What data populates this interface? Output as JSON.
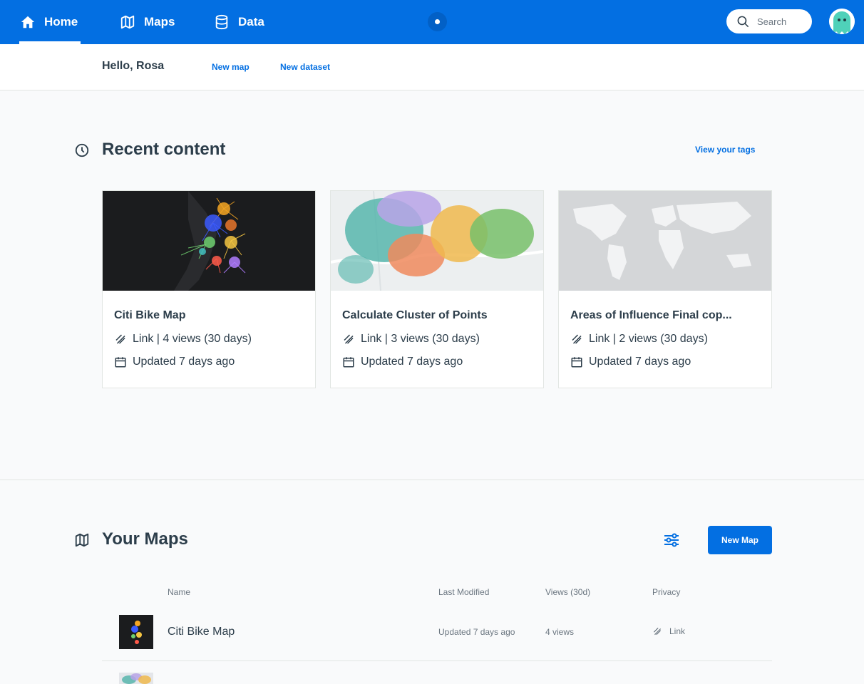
{
  "nav": {
    "items": [
      {
        "label": "Home",
        "icon": "home-icon",
        "active": true
      },
      {
        "label": "Maps",
        "icon": "map-icon",
        "active": false
      },
      {
        "label": "Data",
        "icon": "database-icon",
        "active": false
      }
    ],
    "search_placeholder": "Search"
  },
  "subheader": {
    "greeting": "Hello, Rosa",
    "new_map": "New map",
    "new_dataset": "New dataset"
  },
  "recent": {
    "title": "Recent content",
    "view_tags": "View your tags",
    "cards": [
      {
        "title": "Citi Bike Map",
        "privacy_views": "Link | 4 views (30 days)",
        "updated": "Updated 7 days ago"
      },
      {
        "title": "Calculate Cluster of Points",
        "privacy_views": "Link | 3 views (30 days)",
        "updated": "Updated 7 days ago"
      },
      {
        "title": "Areas of Influence Final cop...",
        "privacy_views": "Link | 2 views (30 days)",
        "updated": "Updated 7 days ago"
      }
    ]
  },
  "maps": {
    "title": "Your Maps",
    "new_map_button": "New Map",
    "columns": {
      "name": "Name",
      "last_modified": "Last Modified",
      "views": "Views (30d)",
      "privacy": "Privacy"
    },
    "rows": [
      {
        "name": "Citi Bike Map",
        "last_modified": "Updated 7 days ago",
        "views": "4 views",
        "privacy": "Link"
      }
    ]
  },
  "colors": {
    "brand": "#036fe2",
    "text": "#2c3d4a",
    "muted": "#6b7680"
  }
}
